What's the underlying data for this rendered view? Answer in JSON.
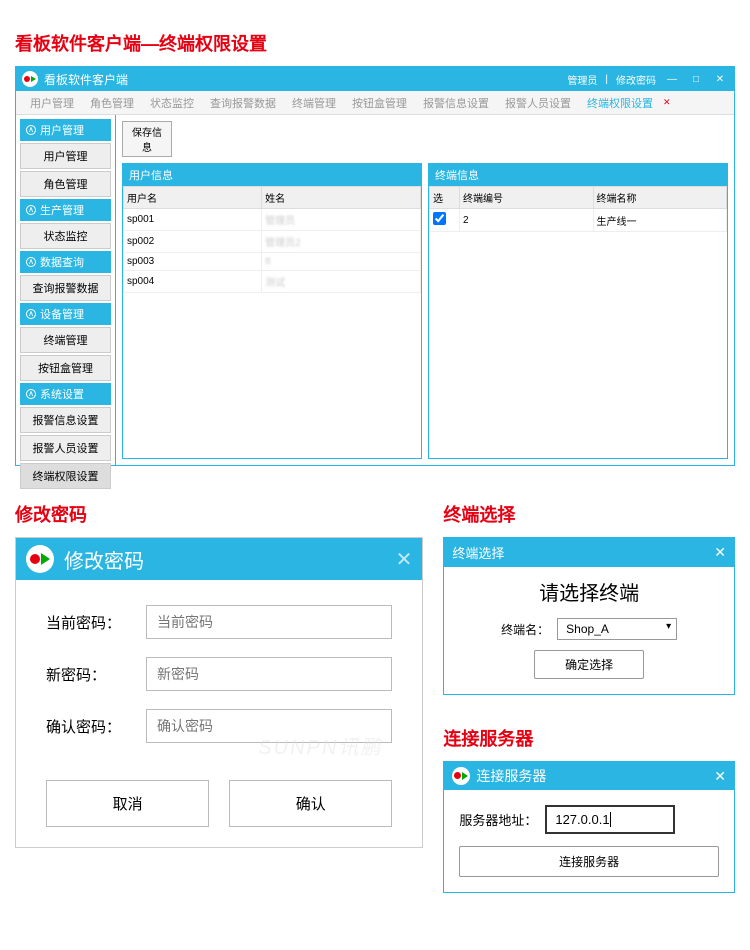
{
  "section1_title": "看板软件客户端—终端权限设置",
  "app": {
    "title": "看板软件客户端",
    "right_links": [
      "管理员",
      "修改密码"
    ],
    "tabs": [
      "用户管理",
      "角色管理",
      "状态监控",
      "查询报警数据",
      "终端管理",
      "按钮盒管理",
      "报警信息设置",
      "报警人员设置",
      "终端权限设置"
    ],
    "active_tab_index": 8,
    "save_btn": "保存信息",
    "sidebar": [
      {
        "header": "用户管理",
        "items": [
          "用户管理",
          "角色管理"
        ]
      },
      {
        "header": "生产管理",
        "items": [
          "状态监控"
        ]
      },
      {
        "header": "数据查询",
        "items": [
          "查询报警数据"
        ]
      },
      {
        "header": "设备管理",
        "items": [
          "终端管理",
          "按钮盒管理"
        ]
      },
      {
        "header": "系统设置",
        "items": [
          "报警信息设置",
          "报警人员设置",
          "终端权限设置"
        ]
      }
    ],
    "active_side_item": "终端权限设置",
    "panel_user": {
      "title": "用户信息",
      "cols": [
        "用户名",
        "姓名"
      ],
      "rows": [
        {
          "u": "sp001",
          "n": "管理员"
        },
        {
          "u": "sp002",
          "n": "管理员2"
        },
        {
          "u": "sp003",
          "n": "tt"
        },
        {
          "u": "sp004",
          "n": "测试"
        }
      ]
    },
    "panel_term": {
      "title": "终端信息",
      "cols": [
        "选",
        "终端编号",
        "终端名称"
      ],
      "rows": [
        {
          "checked": true,
          "id": "2",
          "name": "生产线一"
        }
      ]
    }
  },
  "section2_title": "修改密码",
  "pwd_dialog": {
    "title": "修改密码",
    "current_label": "当前密码：",
    "current_ph": "当前密码",
    "new_label": "新密码：",
    "new_ph": "新密码",
    "confirm_label": "确认密码：",
    "confirm_ph": "确认密码",
    "cancel": "取消",
    "ok": "确认",
    "watermark": "SUNPN讯鹏"
  },
  "section3_title": "终端选择",
  "term_dialog": {
    "header": "终端选择",
    "title": "请选择终端",
    "label": "终端名：",
    "value": "Shop_A",
    "confirm": "确定选择"
  },
  "section4_title": "连接服务器",
  "conn_dialog": {
    "header": "连接服务器",
    "label": "服务器地址：",
    "value": "127.0.0.1",
    "btn": "连接服务器"
  }
}
